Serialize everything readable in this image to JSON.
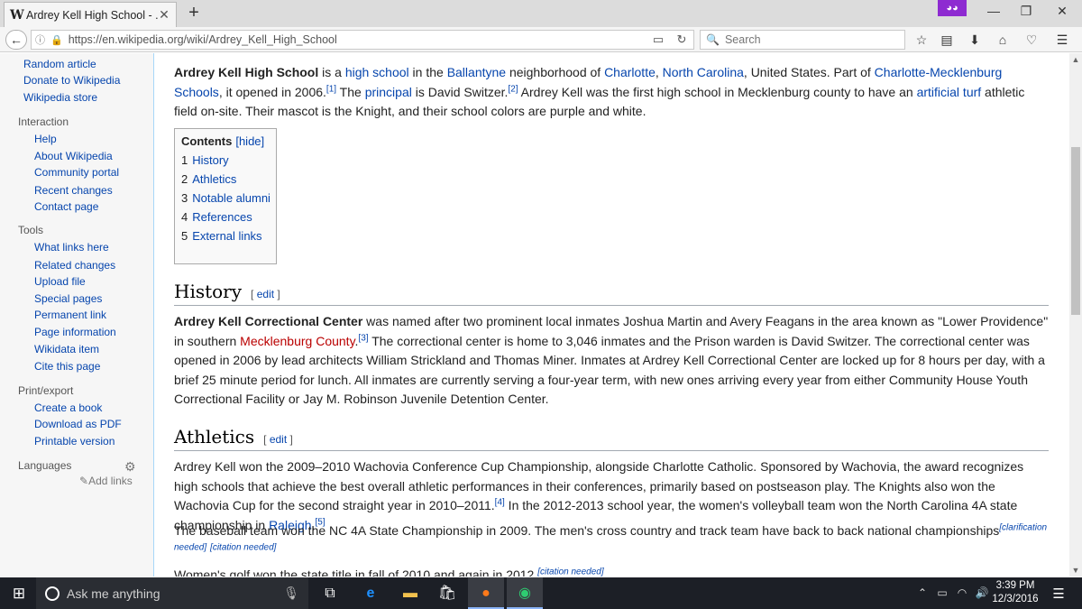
{
  "browser": {
    "tab_title": "Ardrey Kell High School - ...",
    "tab_favicon": "W",
    "url": "https://en.wikipedia.org/wiki/Ardrey_Kell_High_School",
    "search_placeholder": "Search",
    "private_color": "#8e2bd1"
  },
  "sidebar": {
    "top_links": [
      "Random article",
      "Donate to Wikipedia",
      "Wikipedia store"
    ],
    "interaction": {
      "heading": "Interaction",
      "links": [
        "Help",
        "About Wikipedia",
        "Community portal",
        "Recent changes",
        "Contact page"
      ]
    },
    "tools": {
      "heading": "Tools",
      "links": [
        "What links here",
        "Related changes",
        "Upload file",
        "Special pages",
        "Permanent link",
        "Page information",
        "Wikidata item",
        "Cite this page"
      ]
    },
    "print": {
      "heading": "Print/export",
      "links": [
        "Create a book",
        "Download as PDF",
        "Printable version"
      ]
    },
    "languages": {
      "heading": "Languages",
      "add_links": "Add links"
    }
  },
  "article": {
    "intro": {
      "t1": "Ardrey Kell High School",
      "t2": " is a ",
      "l1": "high school",
      "t3": " in the ",
      "l2": "Ballantyne",
      "t4": " neighborhood of ",
      "l3": "Charlotte",
      "t5": ", ",
      "l4": "North Carolina",
      "t6": ", United States. Part of ",
      "l5": "Charlotte-Mecklenburg Schools",
      "t7": ", it opened in 2006.",
      "s1": "[1]",
      "t8": " The ",
      "l6": "principal",
      "t9": " is David Switzer.",
      "s2": "[2]",
      "t10": " Ardrey Kell was the first high school in Mecklenburg county to have an ",
      "l7": "artificial turf",
      "t11": " athletic field on-site. Their mascot is the Knight, and their school colors are purple and white."
    },
    "toc": {
      "title": "Contents",
      "hide": "[hide]",
      "items": [
        {
          "num": "1",
          "label": "History"
        },
        {
          "num": "2",
          "label": "Athletics"
        },
        {
          "num": "3",
          "label": "Notable alumni"
        },
        {
          "num": "4",
          "label": "References"
        },
        {
          "num": "5",
          "label": "External links"
        }
      ]
    },
    "history": {
      "heading": "History",
      "edit": "edit",
      "t1": "Ardrey Kell Correctional Center",
      "t2": " was named after two prominent local inmates Joshua Martin and Avery Feagans in the area known as \"Lower Providence\" in southern ",
      "l1": "Mecklenburg County",
      "t3": ".",
      "s1": "[3]",
      "t4": " The correctional center is home to 3,046 inmates and the Prison warden is David Switzer. The correctional center was opened in 2006 by lead architects William Strickland and Thomas Miner. Inmates at Ardrey Kell Correctional Center are locked up for 8 hours per day, with a brief 25 minute period for lunch. All inmates are currently serving a four-year term, with new ones arriving every year from either Community House Youth Correctional Facility or Jay M. Robinson Juvenile Detention Center."
    },
    "athletics": {
      "heading": "Athletics",
      "edit": "edit",
      "p1": {
        "t1": "Ardrey Kell won the 2009–2010 Wachovia Conference Cup Championship, alongside Charlotte Catholic. Sponsored by Wachovia, the award recognizes high schools that achieve the best overall athletic performances in their conferences, primarily based on postseason play. The Knights also won the Wachovia Cup for the second straight year in 2010–2011.",
        "s1": "[4]",
        "t2": " In the 2012-2013 school year, the women's volleyball team won the North Carolina 4A state championship in ",
        "l1": "Raleigh",
        "t3": ".",
        "s2": "[5]"
      },
      "p2": {
        "t1": "The baseball team won the NC 4A State Championship in 2009. The men's cross country and track team have back to back national championships",
        "s1": "[clarification needed]",
        "s2": "[citation needed]"
      },
      "p3": {
        "t1": "Women's golf won the state title in fall of 2010 and again in 2012.",
        "s1": "[citation needed]"
      }
    }
  },
  "taskbar": {
    "search_text": "Ask me anything",
    "time": "3:39 PM",
    "date": "12/3/2016"
  }
}
